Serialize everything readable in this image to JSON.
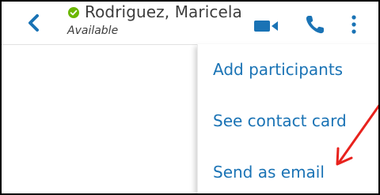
{
  "header": {
    "contact_name": "Rodriguez, Maricela",
    "contact_status": "Available",
    "icons": {
      "back": "chevron-left-icon",
      "presence": "check-circle-icon",
      "video": "video-camera-icon",
      "call": "phone-icon",
      "more": "more-vertical-icon"
    }
  },
  "menu": {
    "items": [
      {
        "label": "Add participants"
      },
      {
        "label": "See contact card"
      },
      {
        "label": "Send as email"
      }
    ]
  },
  "colors": {
    "accent": "#1a73b5",
    "presence_green": "#6bb700",
    "annotation_arrow": "#e8221d",
    "text": "#3d3d3d"
  }
}
